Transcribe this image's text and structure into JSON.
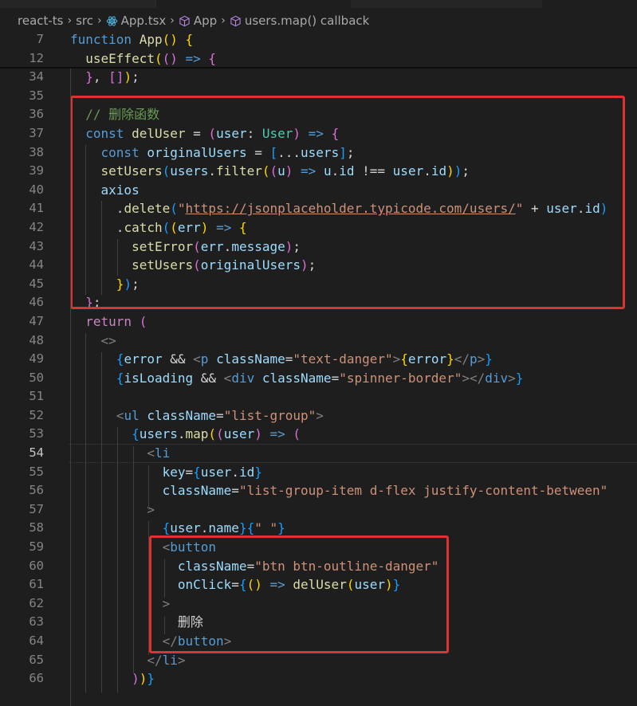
{
  "breadcrumb": {
    "items": [
      "react-ts",
      "src",
      "App.tsx",
      "App",
      "users.map() callback"
    ]
  },
  "colors": {
    "background": "#1e1e1e",
    "highlight_box": "#e03131",
    "keyword": "#569cd6",
    "control_keyword": "#c586c0",
    "function": "#dcdcaa",
    "variable": "#9cdcfe",
    "type": "#4ec9b0",
    "string": "#ce9178",
    "comment": "#6a9955"
  },
  "current_line": "54",
  "lines": [
    {
      "n": "7",
      "sticky": true,
      "tokens": [
        [
          "kw",
          "function"
        ],
        [
          "txt",
          " "
        ],
        [
          "fn",
          "App"
        ],
        [
          "b1",
          "()"
        ],
        [
          "txt",
          " "
        ],
        [
          "b1",
          "{"
        ]
      ]
    },
    {
      "n": "12",
      "sticky": true,
      "tokens": [
        [
          "txt",
          "  "
        ],
        [
          "fn",
          "useEffect"
        ],
        [
          "b1",
          "("
        ],
        [
          "b2",
          "()"
        ],
        [
          "txt",
          " "
        ],
        [
          "kw",
          "=>"
        ],
        [
          "txt",
          " "
        ],
        [
          "b2",
          "{"
        ]
      ]
    },
    {
      "n": "34",
      "tokens": [
        [
          "txt",
          "  "
        ],
        [
          "b2",
          "}"
        ],
        [
          "txt",
          ", "
        ],
        [
          "b2",
          "[]"
        ],
        [
          "b1",
          ")"
        ],
        [
          "txt",
          ";"
        ]
      ]
    },
    {
      "n": "35",
      "tokens": []
    },
    {
      "n": "36",
      "tokens": [
        [
          "txt",
          "  "
        ],
        [
          "cm",
          "// 删除函数"
        ]
      ]
    },
    {
      "n": "37",
      "tokens": [
        [
          "txt",
          "  "
        ],
        [
          "kw",
          "const"
        ],
        [
          "txt",
          " "
        ],
        [
          "fn",
          "delUser"
        ],
        [
          "txt",
          " = "
        ],
        [
          "b2",
          "("
        ],
        [
          "var",
          "user"
        ],
        [
          "txt",
          ": "
        ],
        [
          "ty",
          "User"
        ],
        [
          "b2",
          ")"
        ],
        [
          "txt",
          " "
        ],
        [
          "kw",
          "=>"
        ],
        [
          "txt",
          " "
        ],
        [
          "b2",
          "{"
        ]
      ]
    },
    {
      "n": "38",
      "tokens": [
        [
          "txt",
          "    "
        ],
        [
          "kw",
          "const"
        ],
        [
          "txt",
          " "
        ],
        [
          "var",
          "originalUsers"
        ],
        [
          "txt",
          " = "
        ],
        [
          "b3",
          "["
        ],
        [
          "txt",
          "..."
        ],
        [
          "var",
          "users"
        ],
        [
          "b3",
          "]"
        ],
        [
          "txt",
          ";"
        ]
      ]
    },
    {
      "n": "39",
      "tokens": [
        [
          "txt",
          "    "
        ],
        [
          "fn",
          "setUsers"
        ],
        [
          "b3",
          "("
        ],
        [
          "var",
          "users"
        ],
        [
          "txt",
          "."
        ],
        [
          "fn",
          "filter"
        ],
        [
          "b1",
          "("
        ],
        [
          "b2",
          "("
        ],
        [
          "var",
          "u"
        ],
        [
          "b2",
          ")"
        ],
        [
          "txt",
          " "
        ],
        [
          "kw",
          "=>"
        ],
        [
          "txt",
          " "
        ],
        [
          "var",
          "u"
        ],
        [
          "txt",
          "."
        ],
        [
          "var",
          "id"
        ],
        [
          "txt",
          " !== "
        ],
        [
          "var",
          "user"
        ],
        [
          "txt",
          "."
        ],
        [
          "var",
          "id"
        ],
        [
          "b1",
          ")"
        ],
        [
          "b3",
          ")"
        ],
        [
          "txt",
          ";"
        ]
      ]
    },
    {
      "n": "40",
      "tokens": [
        [
          "txt",
          "    "
        ],
        [
          "var",
          "axios"
        ]
      ]
    },
    {
      "n": "41",
      "tokens": [
        [
          "txt",
          "      ."
        ],
        [
          "fn",
          "delete"
        ],
        [
          "b3",
          "("
        ],
        [
          "str",
          "\""
        ],
        [
          "str url",
          "https://jsonplaceholder.typicode.com/users/"
        ],
        [
          "str",
          "\""
        ],
        [
          "txt",
          " + "
        ],
        [
          "var",
          "user"
        ],
        [
          "txt",
          "."
        ],
        [
          "var",
          "id"
        ],
        [
          "b3",
          ")"
        ]
      ]
    },
    {
      "n": "42",
      "tokens": [
        [
          "txt",
          "      ."
        ],
        [
          "fn",
          "catch"
        ],
        [
          "b3",
          "("
        ],
        [
          "b1",
          "("
        ],
        [
          "var",
          "err"
        ],
        [
          "b1",
          ")"
        ],
        [
          "txt",
          " "
        ],
        [
          "kw",
          "=>"
        ],
        [
          "txt",
          " "
        ],
        [
          "b1",
          "{"
        ]
      ]
    },
    {
      "n": "43",
      "tokens": [
        [
          "txt",
          "        "
        ],
        [
          "fn",
          "setError"
        ],
        [
          "b2",
          "("
        ],
        [
          "var",
          "err"
        ],
        [
          "txt",
          "."
        ],
        [
          "var",
          "message"
        ],
        [
          "b2",
          ")"
        ],
        [
          "txt",
          ";"
        ]
      ]
    },
    {
      "n": "44",
      "tokens": [
        [
          "txt",
          "        "
        ],
        [
          "fn",
          "setUsers"
        ],
        [
          "b2",
          "("
        ],
        [
          "var",
          "originalUsers"
        ],
        [
          "b2",
          ")"
        ],
        [
          "txt",
          ";"
        ]
      ]
    },
    {
      "n": "45",
      "tokens": [
        [
          "txt",
          "      "
        ],
        [
          "b1",
          "}"
        ],
        [
          "b3",
          ")"
        ],
        [
          "txt",
          ";"
        ]
      ]
    },
    {
      "n": "46",
      "tokens": [
        [
          "txt",
          "  "
        ],
        [
          "b2",
          "}"
        ],
        [
          "txt",
          ";"
        ]
      ]
    },
    {
      "n": "47",
      "tokens": [
        [
          "txt",
          "  "
        ],
        [
          "kw2",
          "return"
        ],
        [
          "txt",
          " "
        ],
        [
          "b2",
          "("
        ]
      ]
    },
    {
      "n": "48",
      "tokens": [
        [
          "txt",
          "    "
        ],
        [
          "punct",
          "<>"
        ]
      ]
    },
    {
      "n": "49",
      "tokens": [
        [
          "txt",
          "      "
        ],
        [
          "b3",
          "{"
        ],
        [
          "var",
          "error"
        ],
        [
          "txt",
          " && "
        ],
        [
          "punct",
          "<"
        ],
        [
          "tag",
          "p"
        ],
        [
          "txt",
          " "
        ],
        [
          "attr",
          "className"
        ],
        [
          "txt",
          "="
        ],
        [
          "str",
          "\"text-danger\""
        ],
        [
          "punct",
          ">"
        ],
        [
          "b1",
          "{"
        ],
        [
          "var",
          "error"
        ],
        [
          "b1",
          "}"
        ],
        [
          "punct",
          "</"
        ],
        [
          "tag",
          "p"
        ],
        [
          "punct",
          ">"
        ],
        [
          "b3",
          "}"
        ]
      ]
    },
    {
      "n": "50",
      "tokens": [
        [
          "txt",
          "      "
        ],
        [
          "b3",
          "{"
        ],
        [
          "var",
          "isLoading"
        ],
        [
          "txt",
          " && "
        ],
        [
          "punct",
          "<"
        ],
        [
          "tag",
          "div"
        ],
        [
          "txt",
          " "
        ],
        [
          "attr",
          "className"
        ],
        [
          "txt",
          "="
        ],
        [
          "str",
          "\"spinner-border\""
        ],
        [
          "punct",
          "></"
        ],
        [
          "tag",
          "div"
        ],
        [
          "punct",
          ">"
        ],
        [
          "b3",
          "}"
        ]
      ]
    },
    {
      "n": "51",
      "tokens": []
    },
    {
      "n": "52",
      "tokens": [
        [
          "txt",
          "      "
        ],
        [
          "punct",
          "<"
        ],
        [
          "tag",
          "ul"
        ],
        [
          "txt",
          " "
        ],
        [
          "attr",
          "className"
        ],
        [
          "txt",
          "="
        ],
        [
          "str",
          "\"list-group\""
        ],
        [
          "punct",
          ">"
        ]
      ]
    },
    {
      "n": "53",
      "tokens": [
        [
          "txt",
          "        "
        ],
        [
          "b3",
          "{"
        ],
        [
          "var",
          "users"
        ],
        [
          "txt",
          "."
        ],
        [
          "fn",
          "map"
        ],
        [
          "b1",
          "("
        ],
        [
          "b2",
          "("
        ],
        [
          "var",
          "user"
        ],
        [
          "b2",
          ")"
        ],
        [
          "txt",
          " "
        ],
        [
          "kw",
          "=>"
        ],
        [
          "txt",
          " "
        ],
        [
          "b2",
          "("
        ]
      ]
    },
    {
      "n": "54",
      "tokens": [
        [
          "txt",
          "          "
        ],
        [
          "punct",
          "<"
        ],
        [
          "tag",
          "li"
        ]
      ]
    },
    {
      "n": "55",
      "tokens": [
        [
          "txt",
          "            "
        ],
        [
          "attr",
          "key"
        ],
        [
          "txt",
          "="
        ],
        [
          "b3",
          "{"
        ],
        [
          "var",
          "user"
        ],
        [
          "txt",
          "."
        ],
        [
          "var",
          "id"
        ],
        [
          "b3",
          "}"
        ]
      ]
    },
    {
      "n": "56",
      "tokens": [
        [
          "txt",
          "            "
        ],
        [
          "attr",
          "className"
        ],
        [
          "txt",
          "="
        ],
        [
          "str",
          "\"list-group-item d-flex justify-content-between\""
        ]
      ]
    },
    {
      "n": "57",
      "tokens": [
        [
          "txt",
          "          "
        ],
        [
          "punct",
          ">"
        ]
      ]
    },
    {
      "n": "58",
      "tokens": [
        [
          "txt",
          "            "
        ],
        [
          "b3",
          "{"
        ],
        [
          "var",
          "user"
        ],
        [
          "txt",
          "."
        ],
        [
          "var",
          "name"
        ],
        [
          "b3",
          "}"
        ],
        [
          "b3",
          "{"
        ],
        [
          "str",
          "\" \""
        ],
        [
          "b3",
          "}"
        ]
      ]
    },
    {
      "n": "59",
      "tokens": [
        [
          "txt",
          "            "
        ],
        [
          "punct",
          "<"
        ],
        [
          "tag",
          "button"
        ]
      ]
    },
    {
      "n": "60",
      "tokens": [
        [
          "txt",
          "              "
        ],
        [
          "attr",
          "className"
        ],
        [
          "txt",
          "="
        ],
        [
          "str",
          "\"btn btn-outline-danger\""
        ]
      ]
    },
    {
      "n": "61",
      "tokens": [
        [
          "txt",
          "              "
        ],
        [
          "attr",
          "onClick"
        ],
        [
          "txt",
          "="
        ],
        [
          "b3",
          "{"
        ],
        [
          "b1",
          "()"
        ],
        [
          "txt",
          " "
        ],
        [
          "kw",
          "=>"
        ],
        [
          "txt",
          " "
        ],
        [
          "fn",
          "delUser"
        ],
        [
          "b1",
          "("
        ],
        [
          "var",
          "user"
        ],
        [
          "b1",
          ")"
        ],
        [
          "b3",
          "}"
        ]
      ]
    },
    {
      "n": "62",
      "tokens": [
        [
          "txt",
          "            "
        ],
        [
          "punct",
          ">"
        ]
      ]
    },
    {
      "n": "63",
      "tokens": [
        [
          "txt",
          "              删除"
        ]
      ]
    },
    {
      "n": "64",
      "tokens": [
        [
          "txt",
          "            "
        ],
        [
          "punct",
          "</"
        ],
        [
          "tag",
          "button"
        ],
        [
          "punct",
          ">"
        ]
      ]
    },
    {
      "n": "65",
      "tokens": [
        [
          "txt",
          "          "
        ],
        [
          "punct",
          "</"
        ],
        [
          "tag",
          "li"
        ],
        [
          "punct",
          ">"
        ]
      ]
    },
    {
      "n": "66",
      "tokens": [
        [
          "txt",
          "        "
        ],
        [
          "b2",
          ")"
        ],
        [
          "b1",
          ")"
        ],
        [
          "b3",
          "}"
        ]
      ]
    }
  ]
}
